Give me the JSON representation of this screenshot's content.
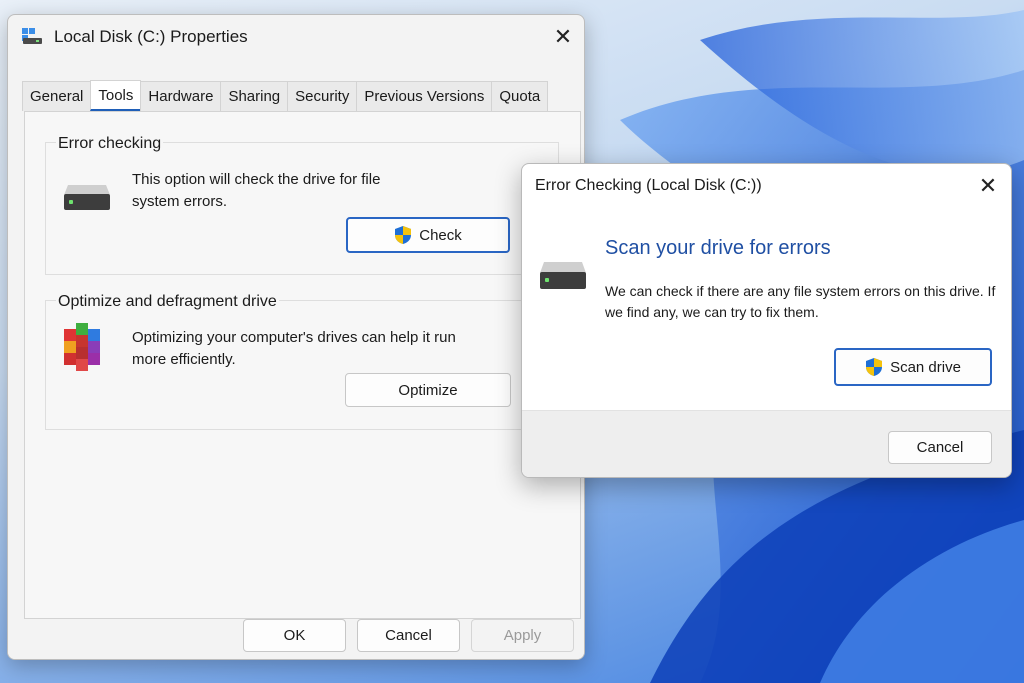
{
  "properties_window": {
    "title": "Local Disk (C:) Properties",
    "close_glyph": "✕",
    "tabs": [
      {
        "label": "General",
        "active": false
      },
      {
        "label": "Tools",
        "active": true
      },
      {
        "label": "Hardware",
        "active": false
      },
      {
        "label": "Sharing",
        "active": false
      },
      {
        "label": "Security",
        "active": false
      },
      {
        "label": "Previous Versions",
        "active": false
      },
      {
        "label": "Quota",
        "active": false
      }
    ],
    "error_checking": {
      "group_label": "Error checking",
      "description": "This option will check the drive for file system errors.",
      "button_label": "Check"
    },
    "optimize": {
      "group_label": "Optimize and defragment drive",
      "description": "Optimizing your computer's drives can help it run more efficiently.",
      "button_label": "Optimize"
    },
    "footer": {
      "ok_label": "OK",
      "cancel_label": "Cancel",
      "apply_label": "Apply"
    }
  },
  "error_dialog": {
    "title": "Error Checking (Local Disk (C:))",
    "close_glyph": "✕",
    "heading": "Scan your drive for errors",
    "description": "We can check if there are any file system errors on this drive. If we find any, we can try to fix them.",
    "scan_label": "Scan drive",
    "cancel_label": "Cancel"
  },
  "icons": {
    "window_icon": "drive-properties-icon",
    "drive": "hard-drive-icon",
    "defrag": "defrag-blocks-icon",
    "uac": "uac-shield-icon"
  },
  "colors": {
    "accent": "#2a66c4",
    "heading_blue": "#1f4fa3",
    "desktop_blue": "#1d5fd6"
  }
}
